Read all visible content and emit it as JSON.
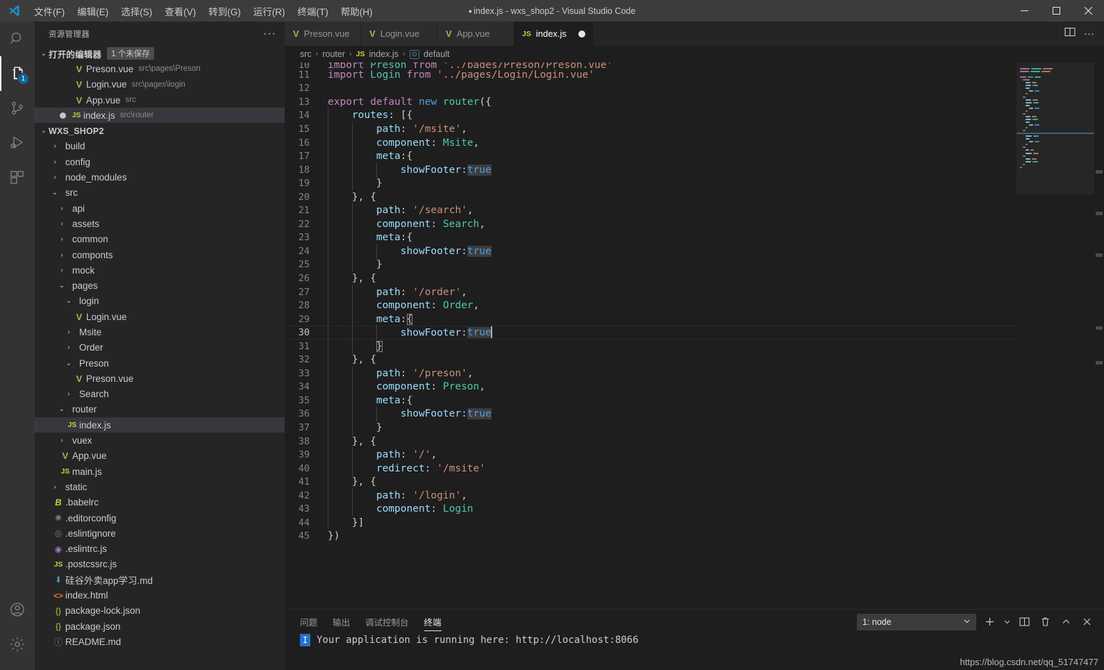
{
  "titlebar": {
    "menus": [
      "文件(F)",
      "编辑(E)",
      "选择(S)",
      "查看(V)",
      "转到(G)",
      "运行(R)",
      "终端(T)",
      "帮助(H)"
    ],
    "title": "index.js - wxs_shop2 - Visual Studio Code",
    "dirty_dot": "●",
    "minimize": "─",
    "maximize": "▢",
    "close": "✕"
  },
  "activitybar": {
    "items": [
      {
        "name": "search-icon",
        "badge": ""
      },
      {
        "name": "explorer-icon",
        "badge": "1"
      },
      {
        "name": "source-control-icon",
        "badge": ""
      },
      {
        "name": "run-debug-icon",
        "badge": ""
      },
      {
        "name": "extensions-icon",
        "badge": ""
      }
    ],
    "bottom": [
      {
        "name": "account-icon"
      },
      {
        "name": "settings-gear-icon"
      }
    ]
  },
  "sidebar": {
    "header": "资源管理器",
    "more": "···",
    "open_editors": {
      "label": "打开的编辑器",
      "badge": "1 个未保存",
      "items": [
        {
          "icon": "vue",
          "name": "Preson.vue",
          "desc": "src\\pages\\Preson",
          "dirty": false,
          "selected": false
        },
        {
          "icon": "vue",
          "name": "Login.vue",
          "desc": "src\\pages\\login",
          "dirty": false,
          "selected": false
        },
        {
          "icon": "vue",
          "name": "App.vue",
          "desc": "src",
          "dirty": false,
          "selected": false
        },
        {
          "icon": "js",
          "name": "index.js",
          "desc": "src\\router",
          "dirty": true,
          "selected": true
        }
      ]
    },
    "project": {
      "label": "WXS_SHOP2",
      "items": [
        {
          "indent": 1,
          "twisty": "collapsed",
          "icon": "",
          "name": "build"
        },
        {
          "indent": 1,
          "twisty": "collapsed",
          "icon": "",
          "name": "config"
        },
        {
          "indent": 1,
          "twisty": "collapsed",
          "icon": "",
          "name": "node_modules"
        },
        {
          "indent": 1,
          "twisty": "expanded",
          "icon": "",
          "name": "src"
        },
        {
          "indent": 2,
          "twisty": "collapsed",
          "icon": "",
          "name": "api"
        },
        {
          "indent": 2,
          "twisty": "collapsed",
          "icon": "",
          "name": "assets"
        },
        {
          "indent": 2,
          "twisty": "collapsed",
          "icon": "",
          "name": "common"
        },
        {
          "indent": 2,
          "twisty": "collapsed",
          "icon": "",
          "name": "componts"
        },
        {
          "indent": 2,
          "twisty": "collapsed",
          "icon": "",
          "name": "mock"
        },
        {
          "indent": 2,
          "twisty": "expanded",
          "icon": "",
          "name": "pages"
        },
        {
          "indent": 3,
          "twisty": "expanded",
          "icon": "",
          "name": "login"
        },
        {
          "indent": 4,
          "twisty": "none",
          "icon": "vue",
          "name": "Login.vue"
        },
        {
          "indent": 3,
          "twisty": "collapsed",
          "icon": "",
          "name": "Msite"
        },
        {
          "indent": 3,
          "twisty": "collapsed",
          "icon": "",
          "name": "Order"
        },
        {
          "indent": 3,
          "twisty": "expanded",
          "icon": "",
          "name": "Preson"
        },
        {
          "indent": 4,
          "twisty": "none",
          "icon": "vue",
          "name": "Preson.vue"
        },
        {
          "indent": 3,
          "twisty": "collapsed",
          "icon": "",
          "name": "Search"
        },
        {
          "indent": 2,
          "twisty": "expanded",
          "icon": "",
          "name": "router"
        },
        {
          "indent": 3,
          "twisty": "none",
          "icon": "js",
          "name": "index.js",
          "selected": true
        },
        {
          "indent": 2,
          "twisty": "collapsed",
          "icon": "",
          "name": "vuex"
        },
        {
          "indent": 2,
          "twisty": "none",
          "icon": "vue",
          "name": "App.vue"
        },
        {
          "indent": 2,
          "twisty": "none",
          "icon": "js",
          "name": "main.js"
        },
        {
          "indent": 1,
          "twisty": "collapsed",
          "icon": "",
          "name": "static"
        },
        {
          "indent": 1,
          "twisty": "none",
          "icon": "babel",
          "name": ".babelrc"
        },
        {
          "indent": 1,
          "twisty": "none",
          "icon": "gear",
          "name": ".editorconfig"
        },
        {
          "indent": 1,
          "twisty": "none",
          "icon": "circle",
          "name": ".eslintignore"
        },
        {
          "indent": 1,
          "twisty": "none",
          "icon": "circle-purple",
          "name": ".eslintrc.js"
        },
        {
          "indent": 1,
          "twisty": "none",
          "icon": "js",
          "name": ".postcssrc.js"
        },
        {
          "indent": 1,
          "twisty": "none",
          "icon": "md",
          "name": "硅谷外卖app学习.md"
        },
        {
          "indent": 1,
          "twisty": "none",
          "icon": "html",
          "name": "index.html"
        },
        {
          "indent": 1,
          "twisty": "none",
          "icon": "json",
          "name": "package-lock.json"
        },
        {
          "indent": 1,
          "twisty": "none",
          "icon": "json",
          "name": "package.json"
        },
        {
          "indent": 1,
          "twisty": "none",
          "icon": "info",
          "name": "README.md"
        }
      ]
    }
  },
  "editor": {
    "tabs": [
      {
        "icon": "vue",
        "label": "Preson.vue",
        "active": false,
        "dirty": false
      },
      {
        "icon": "vue",
        "label": "Login.vue",
        "active": false,
        "dirty": false
      },
      {
        "icon": "vue",
        "label": "App.vue",
        "active": false,
        "dirty": false
      },
      {
        "icon": "js",
        "label": "index.js",
        "active": true,
        "dirty": true
      }
    ],
    "breadcrumb": [
      "src",
      "router",
      "index.js",
      "default"
    ],
    "breadcrumb_file_icon": "js",
    "breadcrumb_symbol_icon": "export-symbol",
    "split_editor_label": "⫴",
    "more_actions_label": "···",
    "first_visible_line": 10,
    "cursor_line": 30,
    "lines": [
      {
        "n": 10,
        "partial": true
      },
      {
        "n": 11
      },
      {
        "n": 12
      },
      {
        "n": 13
      },
      {
        "n": 14
      },
      {
        "n": 15
      },
      {
        "n": 16
      },
      {
        "n": 17
      },
      {
        "n": 18
      },
      {
        "n": 19
      },
      {
        "n": 20
      },
      {
        "n": 21
      },
      {
        "n": 22
      },
      {
        "n": 23
      },
      {
        "n": 24
      },
      {
        "n": 25
      },
      {
        "n": 26
      },
      {
        "n": 27
      },
      {
        "n": 28
      },
      {
        "n": 29
      },
      {
        "n": 30
      },
      {
        "n": 31
      },
      {
        "n": 32
      },
      {
        "n": 33
      },
      {
        "n": 34
      },
      {
        "n": 35
      },
      {
        "n": 36
      },
      {
        "n": 37
      },
      {
        "n": 38
      },
      {
        "n": 39
      },
      {
        "n": 40
      },
      {
        "n": 41
      },
      {
        "n": 42
      },
      {
        "n": 43
      },
      {
        "n": 44
      },
      {
        "n": 45
      }
    ],
    "code_text": {
      "l10": "import Preson from '../pages/Preson/Preson.vue'",
      "l11": "import Login from '../pages/Login/Login.vue'",
      "l12": "",
      "l13": "export default new router({",
      "l14": "    routes: [{",
      "l15": "        path: '/msite',",
      "l16": "        component: Msite,",
      "l17": "        meta:{",
      "l18": "            showFooter:true",
      "l19": "        }",
      "l20": "    }, {",
      "l21": "        path: '/search',",
      "l22": "        component: Search,",
      "l23": "        meta:{",
      "l24": "            showFooter:true",
      "l25": "        }",
      "l26": "    }, {",
      "l27": "        path: '/order',",
      "l28": "        component: Order,",
      "l29": "        meta:{",
      "l30": "            showFooter:true",
      "l31": "        }",
      "l32": "    }, {",
      "l33": "        path: '/preson',",
      "l34": "        component: Preson,",
      "l35": "        meta:{",
      "l36": "            showFooter:true",
      "l37": "        }",
      "l38": "    }, {",
      "l39": "        path: '/',",
      "l40": "        redirect: '/msite'",
      "l41": "    }, {",
      "l42": "        path: '/login',",
      "l43": "        component: Login",
      "l44": "    }]",
      "l45": "})"
    }
  },
  "panel": {
    "tabs": [
      {
        "label": "问题",
        "active": false
      },
      {
        "label": "输出",
        "active": false
      },
      {
        "label": "调试控制台",
        "active": false
      },
      {
        "label": "终端",
        "active": true
      }
    ],
    "terminal_select": "1: node",
    "chevron_down": "⌄",
    "actions": [
      {
        "name": "new-terminal-button",
        "glyph": "+"
      },
      {
        "name": "terminal-dropdown-chevron-icon",
        "glyph": "⌄"
      },
      {
        "name": "split-terminal-button",
        "glyph": "▯▯"
      },
      {
        "name": "kill-terminal-button",
        "glyph": "🗑"
      },
      {
        "name": "maximize-panel-button",
        "glyph": "︿"
      },
      {
        "name": "close-panel-button",
        "glyph": "✕"
      }
    ],
    "terminal_marker": "I",
    "terminal_output": "Your application is running here: http://localhost:8066"
  },
  "watermark": "https://blog.csdn.net/qq_51747477",
  "colors": {
    "accent": "#0e639c",
    "titlebar_bg": "#3c3c3c",
    "sidebar_bg": "#252526",
    "editor_bg": "#1e1e1e",
    "activitybar_bg": "#333333",
    "selection": "#37373d",
    "vue_green": "#8bc34a",
    "js_yellow": "#cbcb41"
  }
}
